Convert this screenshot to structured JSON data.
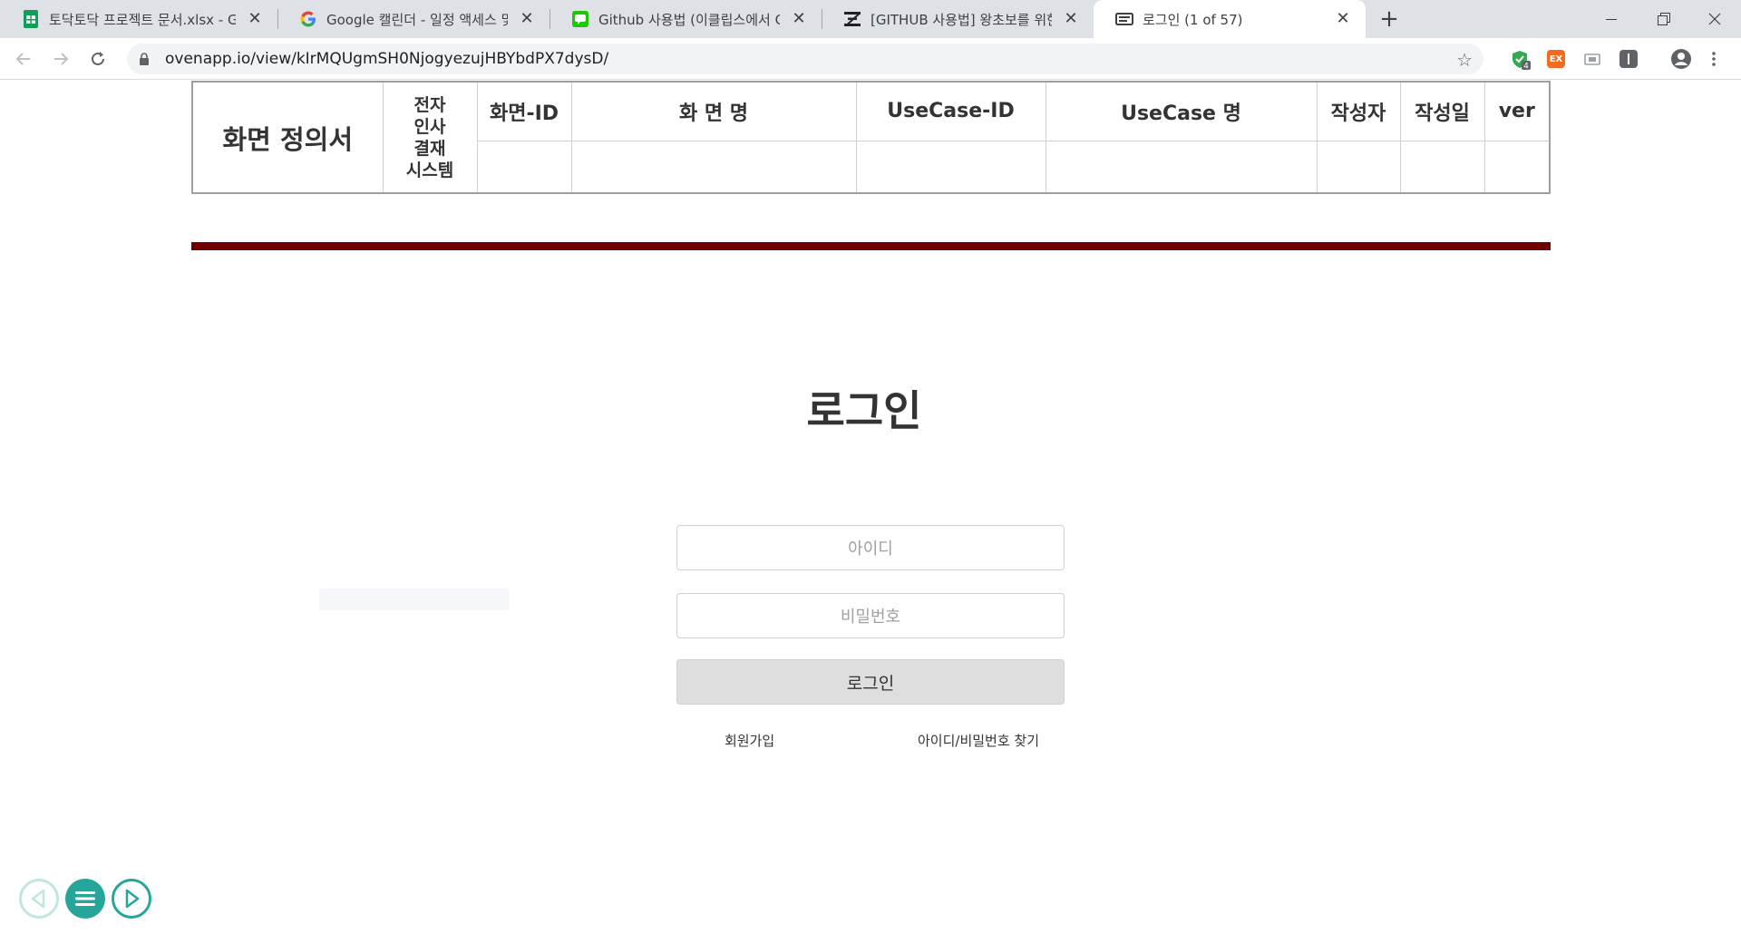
{
  "browser": {
    "tabs": [
      {
        "title": "토닥토닥 프로젝트 문서.xlsx - Go",
        "icon": "google-sheets-icon"
      },
      {
        "title": "Google 캘린더 - 일정 액세스 및",
        "icon": "google-icon"
      },
      {
        "title": "Github 사용법 (이클립스에서 Gi",
        "icon": "line-chat-icon"
      },
      {
        "title": "[GITHUB 사용법] 왕초보를 위한",
        "icon": "z-logo-icon"
      },
      {
        "title": "로그인 (1 of 57)",
        "icon": "slides-icon"
      }
    ],
    "new_tab": "+",
    "url": "ovenapp.io/view/kIrMQUgmSH0NjogyezujHBYbdPX7dysD/",
    "extension_badge": "4",
    "ex_label": "EX"
  },
  "spec": {
    "title": "화면 정의서",
    "system": [
      "전자",
      "인사",
      "결재",
      "시스템"
    ],
    "headers": [
      "화면-ID",
      "화 면 명",
      "UseCase-ID",
      "UseCase 명",
      "작성자",
      "작성일",
      "ver"
    ]
  },
  "login": {
    "title": "로그인",
    "id_placeholder": "아이디",
    "pw_placeholder": "비밀번호",
    "button": "로그인",
    "signup": "회원가입",
    "find": "아이디/비밀번호 찾기"
  },
  "colors": {
    "accent_bar": "#700000",
    "pager": "#26a69a"
  }
}
